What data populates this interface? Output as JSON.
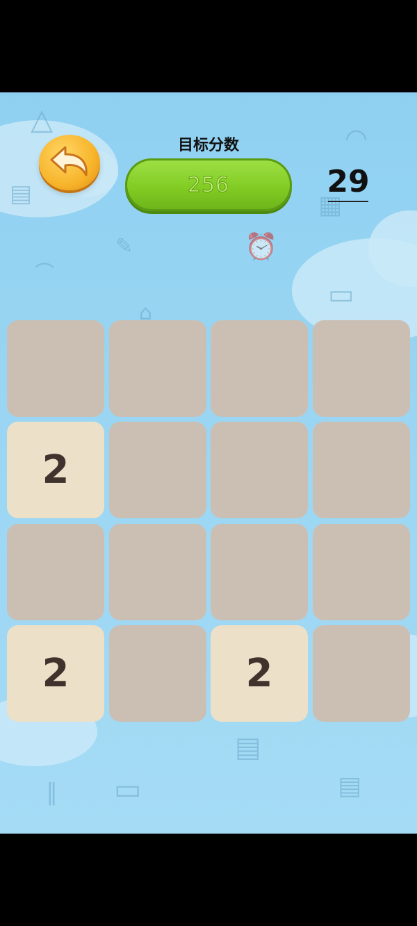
{
  "header": {
    "target_label": "目标分数",
    "target_value": "256",
    "moves": "29"
  },
  "icons": {
    "back": "undo-arrow-icon"
  },
  "board": {
    "rows": 4,
    "cols": 4,
    "cells": [
      [
        "",
        "",
        "",
        ""
      ],
      [
        "2",
        "",
        "",
        ""
      ],
      [
        "",
        "",
        "",
        ""
      ],
      [
        "2",
        "",
        "2",
        ""
      ]
    ]
  },
  "colors": {
    "empty_tile": "#cbbfb4",
    "number_tile": "#ece0c8",
    "number_text": "#40332e",
    "target_pill": "#82cc24",
    "back_button": "#f7b42a",
    "background": "#9ad6f3"
  }
}
